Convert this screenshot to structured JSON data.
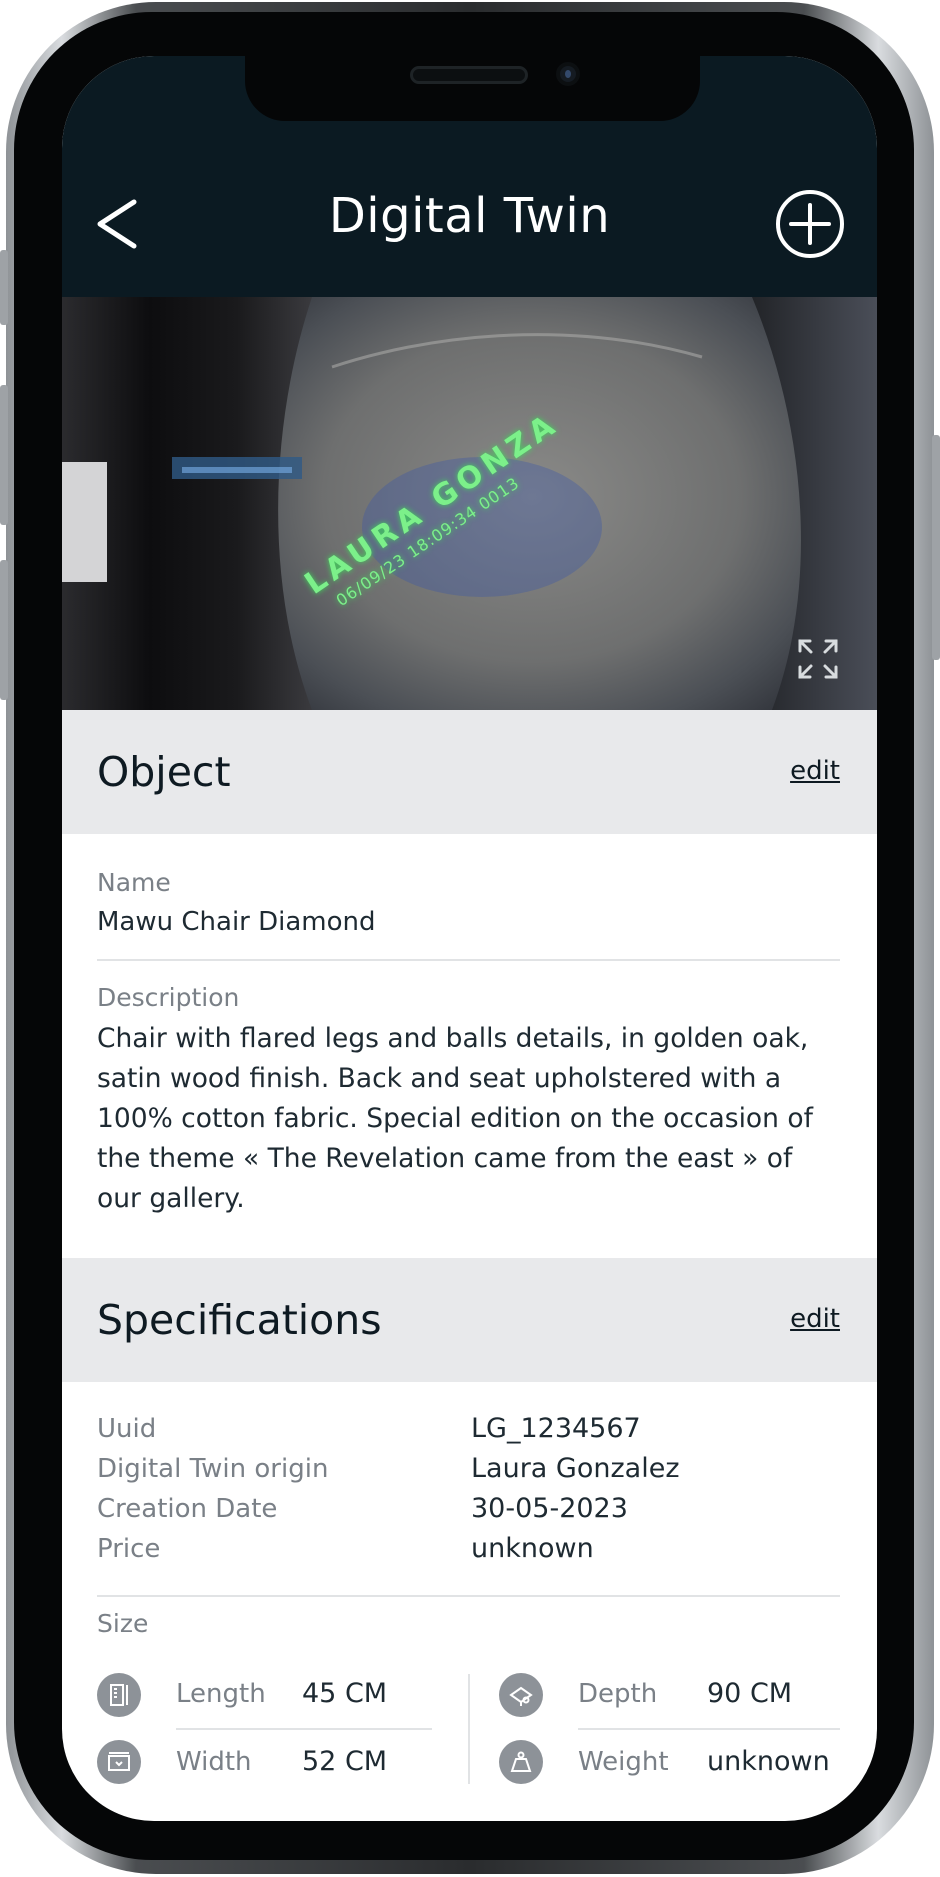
{
  "header": {
    "title": "Digital Twin",
    "back_icon": "chevron-left-icon",
    "add_icon": "plus-circle-icon"
  },
  "photo": {
    "engraving_line1": "LAURA GONZA",
    "engraving_line2": "06/09/23 18:09:34 0013",
    "expand_icon": "expand-icon"
  },
  "object": {
    "title": "Object",
    "edit_label": "edit",
    "name_label": "Name",
    "name_value": "Mawu Chair Diamond",
    "description_label": "Description",
    "description_value": "Chair with flared legs and balls details, in golden oak, satin wood finish. Back and seat upholstered with a 100% cotton fabric. Special edition on the occasion of the theme « The Revelation came from the east » of our gallery."
  },
  "specifications": {
    "title": "Specifications",
    "edit_label": "edit",
    "rows": [
      {
        "label": "Uuid",
        "value": "LG_1234567"
      },
      {
        "label": "Digital Twin origin",
        "value": "Laura Gonzalez"
      },
      {
        "label": "Creation Date",
        "value": "30-05-2023"
      },
      {
        "label": "Price",
        "value": "unknown"
      }
    ],
    "size_label": "Size",
    "size": [
      {
        "label": "Length",
        "value": "45 CM",
        "icon": "length-icon"
      },
      {
        "label": "Width",
        "value": "52 CM",
        "icon": "width-icon"
      },
      {
        "label": "Depth",
        "value": "90 CM",
        "icon": "depth-icon"
      },
      {
        "label": "Weight",
        "value": "unknown",
        "icon": "weight-icon"
      }
    ]
  },
  "colors": {
    "header_bg": "#0b1a22",
    "section_bg": "#e8e9eb",
    "label_gray": "#7a8087",
    "text_dark": "#1e2a32",
    "engraving_green": "#7cf08a"
  }
}
